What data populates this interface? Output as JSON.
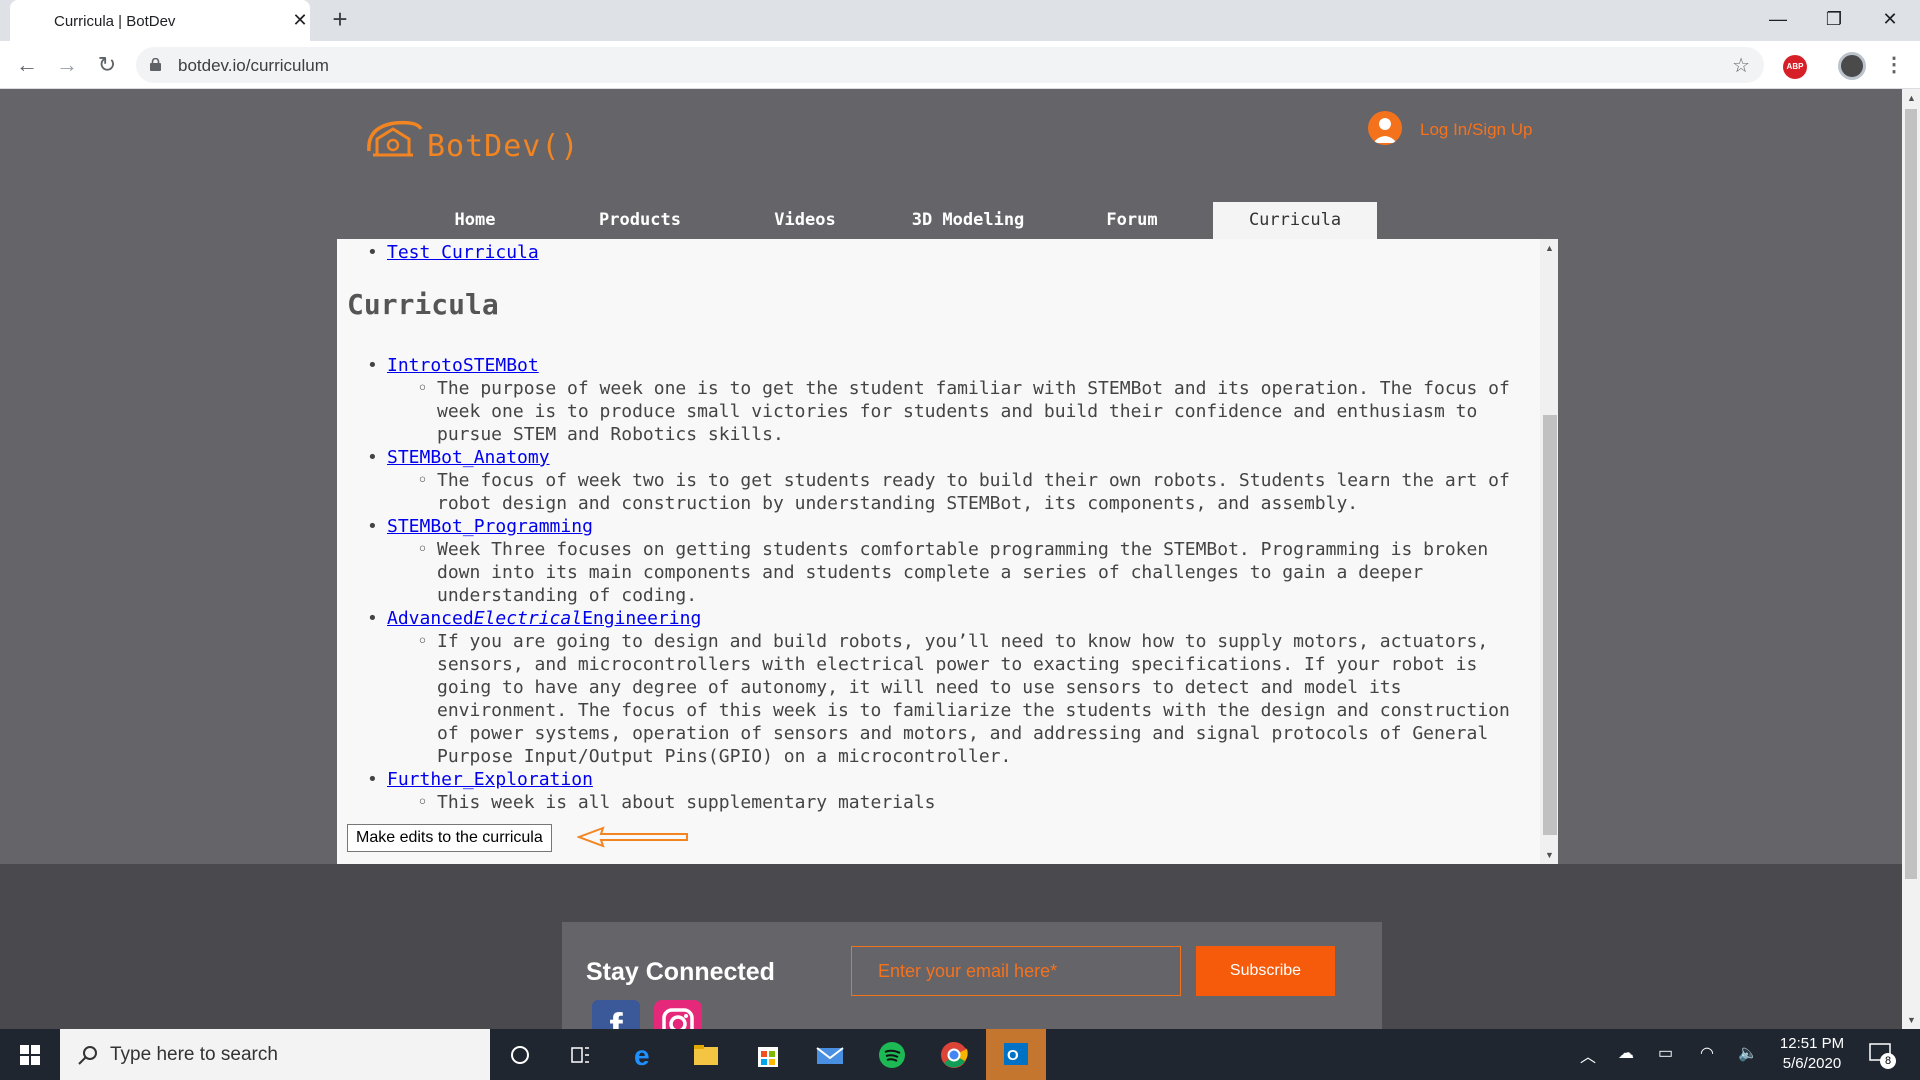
{
  "browser": {
    "tab_title": "Curricula | BotDev",
    "url": "botdev.io/curriculum",
    "abp_label": "ABP"
  },
  "site": {
    "logo_text": "BotDev()",
    "login_label": "Log In/Sign Up",
    "nav": [
      {
        "label": "Home"
      },
      {
        "label": "Products"
      },
      {
        "label": "Videos"
      },
      {
        "label": "3D Modeling"
      },
      {
        "label": "Forum"
      },
      {
        "label": "Curricula",
        "active": true
      }
    ]
  },
  "content": {
    "top_link": "Test Curricula",
    "heading": "Curricula",
    "items": [
      {
        "title": "IntrotoSTEMBot",
        "desc": "The purpose of week one is to get the student familiar with STEMBot and its operation. The focus of week one is to produce small victories for students and build their confidence and enthusiasm to pursue STEM and Robotics skills."
      },
      {
        "title": "STEMBot_Anatomy",
        "desc": "The focus of week two is to get students ready to build their own robots. Students learn the art of robot design and construction by understanding STEMBot, its components, and assembly."
      },
      {
        "title": "STEMBot_Programming",
        "desc": "Week Three focuses on getting students comfortable programming the STEMBot. Programming is broken down into its main components and students complete a series of challenges to gain a deeper understanding of coding."
      },
      {
        "title_parts": [
          "Advanced",
          "Electrical",
          "Engineering"
        ],
        "desc": "If you are going to design and build robots, you’ll need to know how to supply motors, actuators, sensors, and microcontrollers with electrical power to exacting specifications. If your robot is going to have any degree of autonomy, it will need to use sensors to detect and model its environment. The focus of this week is to familiarize the students with the design and construction of power systems, operation of sensors and motors, and addressing and signal protocols of General Purpose Input/Output Pins(GPIO) on a microcontroller."
      },
      {
        "title": "Further_Exploration",
        "desc": "This week is all about supplementary materials"
      }
    ],
    "edit_button": "Make edits to the curricula"
  },
  "footer": {
    "stay_connected": "Stay Connected",
    "email_placeholder": "Enter your email here*",
    "subscribe_label": "Subscribe",
    "facebook_glyph": "f"
  },
  "taskbar": {
    "search_placeholder": "Type here to search",
    "time": "12:51 PM",
    "date": "5/6/2020",
    "notification_count": "8"
  },
  "colors": {
    "brand_orange": "#f5721d",
    "header_gray": "#656469",
    "footer_gray": "#4a494e",
    "link_blue": "#0000ee"
  }
}
